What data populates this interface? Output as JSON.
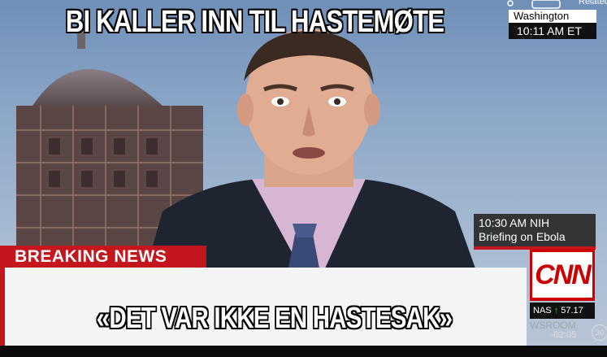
{
  "meme": {
    "top_text": "BI KALLER INN TIL HASTEMØTE",
    "bottom_text": "«DET VAR IKKE EN HASTESAK»"
  },
  "broadcast": {
    "location": "Washington",
    "time": "10:11 AM ET",
    "upnext_line1": "10:30 AM NIH",
    "upnext_line2": "Briefing on Ebola",
    "breaking_label": "BREAKING NEWS",
    "logo": "CNN",
    "ticker_symbol": "NAS",
    "ticker_value": "57.17",
    "elapsed": "-02:05",
    "skip_label": "30",
    "corner_label": "Related",
    "newsroom_label": "WSROOM"
  },
  "colors": {
    "cnn_red": "#cc0000",
    "breaking_red": "#c4161c"
  },
  "icons": [
    "share-icon",
    "cc-icon",
    "replay-30-icon",
    "up-arrow-icon"
  ]
}
